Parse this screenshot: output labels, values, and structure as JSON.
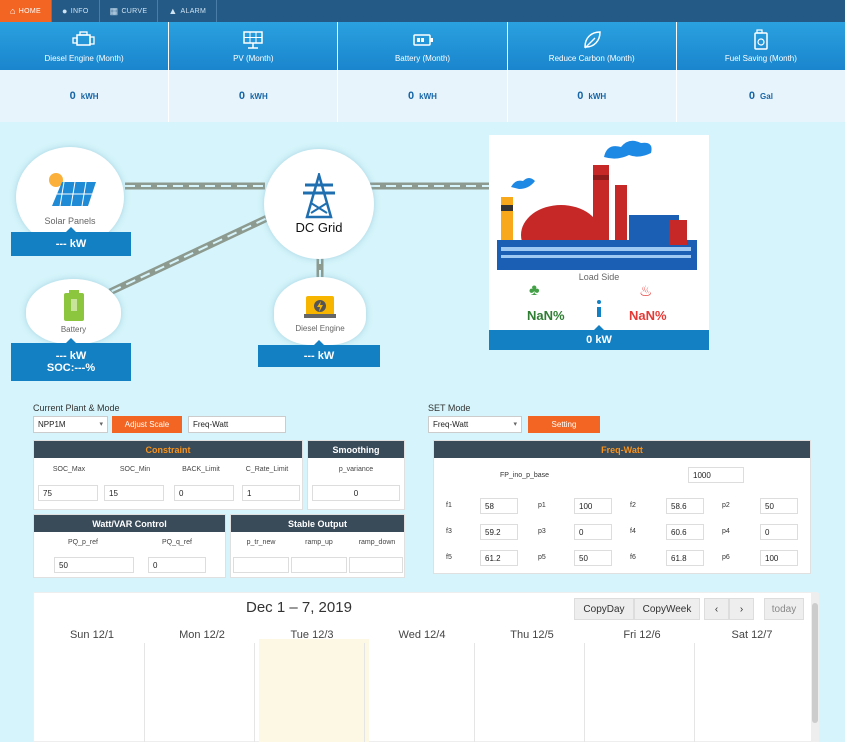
{
  "nav": {
    "tabs": [
      {
        "label": "HOME",
        "icon": "home-icon"
      },
      {
        "label": "INFO",
        "icon": "info-icon"
      },
      {
        "label": "CURVE",
        "icon": "chart-icon"
      },
      {
        "label": "ALARM",
        "icon": "warning-icon"
      }
    ]
  },
  "stats": [
    {
      "name": "Diesel Engine (Month)",
      "value": "0",
      "unit": "kWH",
      "icon": "engine-icon"
    },
    {
      "name": "PV (Month)",
      "value": "0",
      "unit": "kWH",
      "icon": "solar-panel-icon"
    },
    {
      "name": "Battery (Month)",
      "value": "0",
      "unit": "kWH",
      "icon": "battery-icon"
    },
    {
      "name": "Reduce Carbon (Month)",
      "value": "0",
      "unit": "kWH",
      "icon": "leaf-icon"
    },
    {
      "name": "Fuel Saving (Month)",
      "value": "0",
      "unit": "Gal",
      "icon": "fuel-can-icon"
    }
  ],
  "diagram": {
    "solar": {
      "label": "Solar Panels",
      "value": "--- kW"
    },
    "grid": {
      "label": "DC Grid"
    },
    "battery": {
      "label": "Battery",
      "value": "--- kW",
      "soc": "SOC:---%"
    },
    "diesel": {
      "label": "Diesel Engine",
      "value": "--- kW"
    },
    "load": {
      "label": "Load Side",
      "left_pct": "NaN%",
      "right_pct": "NaN%",
      "value": "0 kW"
    }
  },
  "plant": {
    "title": "Current Plant & Mode",
    "plant_value": "NPP1M",
    "adjust_label": "Adjust Scale",
    "mode_value": "Freq-Watt",
    "set_title": "SET Mode",
    "set_value": "Freq-Watt",
    "setting_label": "Setting"
  },
  "constraint": {
    "title": "Constraint",
    "cols": [
      "SOC_Max",
      "SOC_Min",
      "BACK_Limit",
      "C_Rate_Limit"
    ],
    "values": [
      "75",
      "15",
      "0",
      "1"
    ]
  },
  "smoothing": {
    "title": "Smoothing",
    "col": "p_variance",
    "value": "0"
  },
  "wattvar": {
    "title": "Watt/VAR Control",
    "cols": [
      "PQ_p_ref",
      "PQ_q_ref"
    ],
    "values": [
      "50",
      "0"
    ]
  },
  "stable": {
    "title": "Stable Output",
    "cols": [
      "p_tr_new",
      "ramp_up",
      "ramp_down"
    ]
  },
  "freqwatt": {
    "title": "Freq-Watt",
    "base_label": "FP_ino_p_base",
    "base_value": "1000",
    "rows": [
      [
        {
          "l": "f1",
          "v": "58"
        },
        {
          "l": "p1",
          "v": "100"
        },
        {
          "l": "f2",
          "v": "58.6"
        },
        {
          "l": "p2",
          "v": "50"
        }
      ],
      [
        {
          "l": "f3",
          "v": "59.2"
        },
        {
          "l": "p3",
          "v": "0"
        },
        {
          "l": "f4",
          "v": "60.6"
        },
        {
          "l": "p4",
          "v": "0"
        }
      ],
      [
        {
          "l": "f5",
          "v": "61.2"
        },
        {
          "l": "p5",
          "v": "50"
        },
        {
          "l": "f6",
          "v": "61.8"
        },
        {
          "l": "p6",
          "v": "100"
        }
      ]
    ]
  },
  "calendar": {
    "title": "Dec 1 – 7, 2019",
    "copyday": "CopyDay",
    "copyweek": "CopyWeek",
    "prev": "‹",
    "next": "›",
    "today": "today",
    "days": [
      "Sun 12/1",
      "Mon 12/2",
      "Tue 12/3",
      "Wed 12/4",
      "Thu 12/5",
      "Fri 12/6",
      "Sat 12/7"
    ]
  }
}
